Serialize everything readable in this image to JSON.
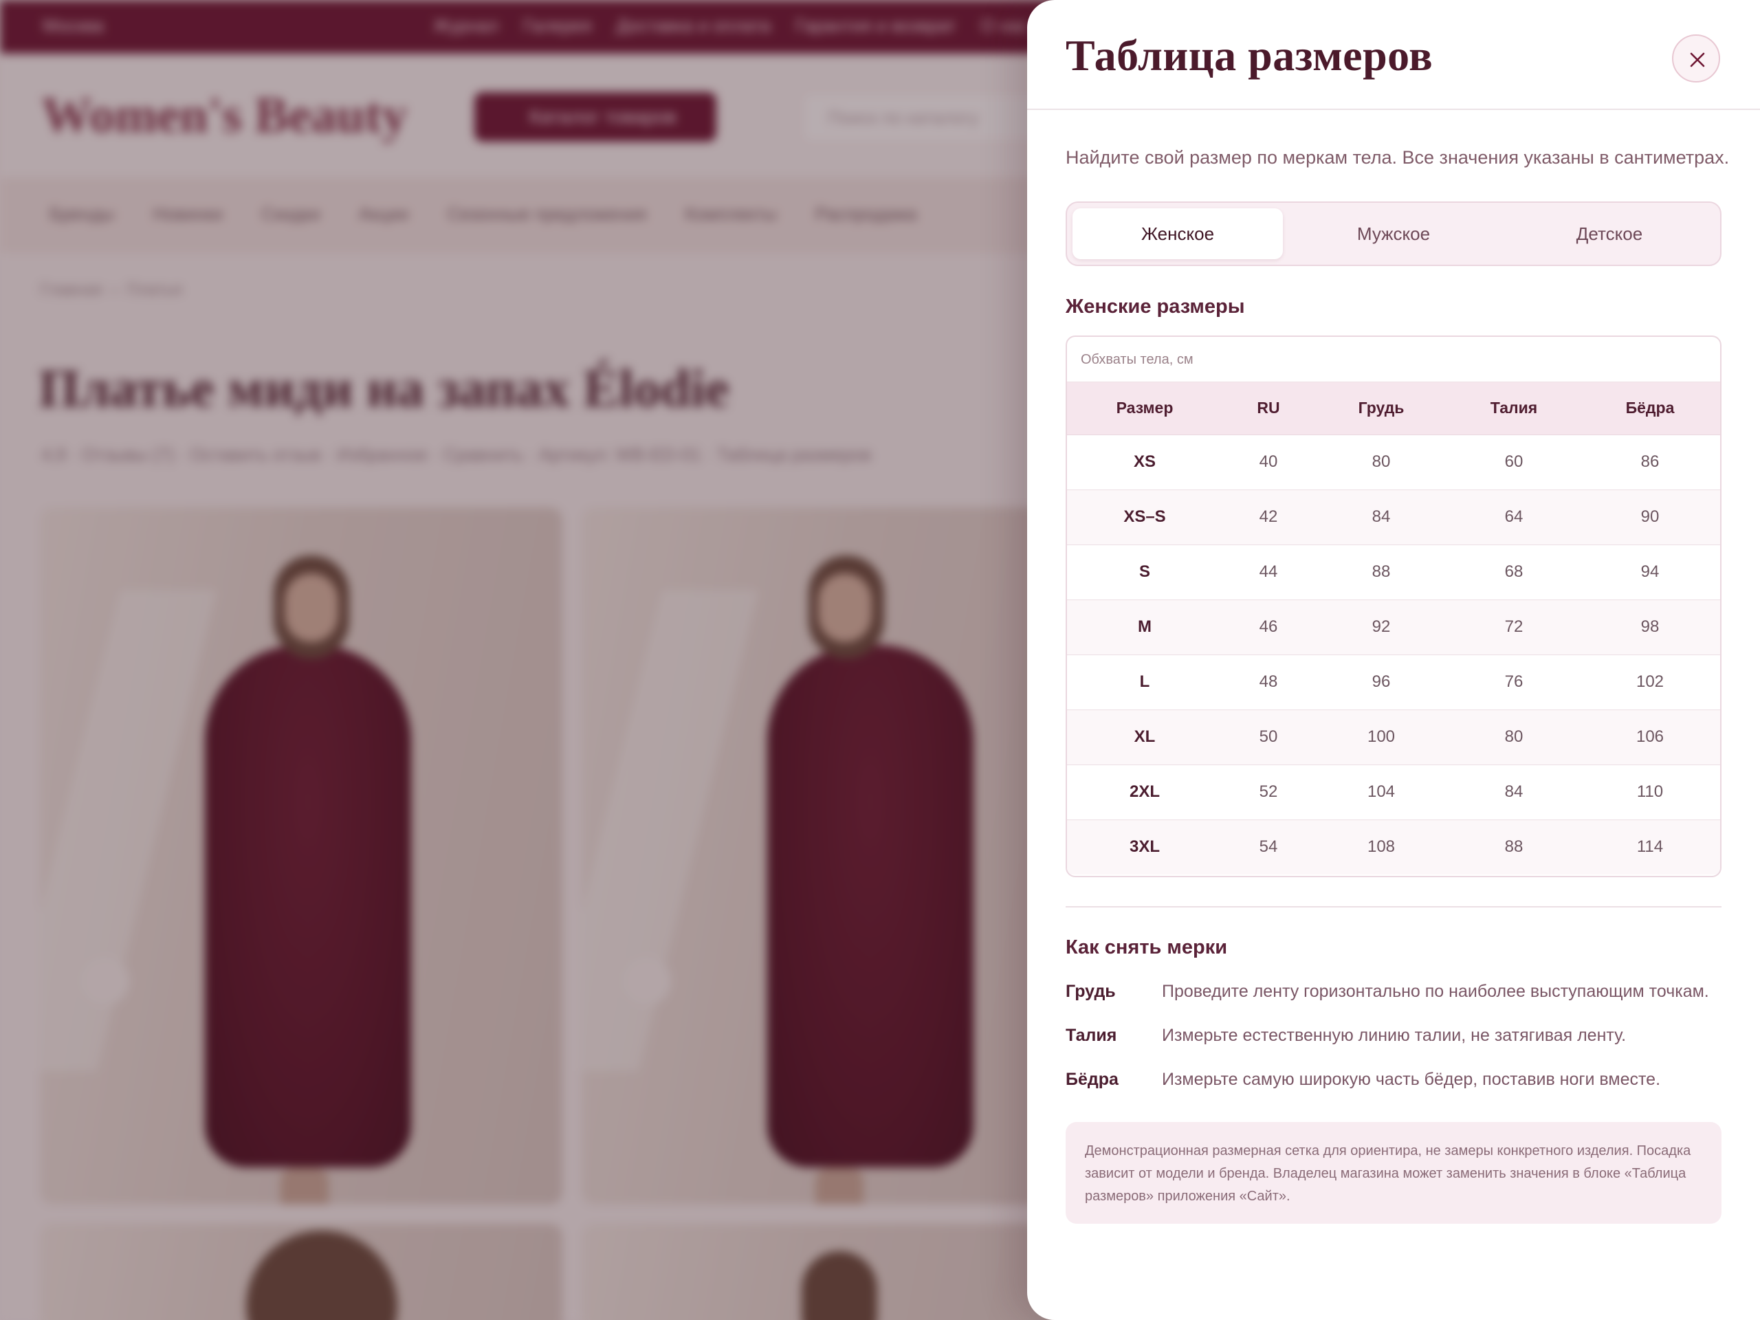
{
  "background": {
    "city": "Москва",
    "top_links": [
      "Журнал",
      "Галерея",
      "Доставка и оплата",
      "Гарантия и возврат",
      "О нас"
    ],
    "logo": "Women's Beauty",
    "catalog_button": "Каталог товаров",
    "search_placeholder": "Поиск по каталогу",
    "category_nav": [
      "Бренды",
      "Новинки",
      "Скидки",
      "Акции",
      "Сезонные предложения",
      "Комплекты",
      "Распродажа"
    ],
    "breadcrumb": [
      "Главная",
      "Платья"
    ],
    "product_title": "Платье миди на запах Élodie",
    "meta": "4,9 · Отзывы (7) · Оставить отзыв · Избранное · Сравнить · Артикул: WB-ED-01 · Таблица размеров"
  },
  "drawer": {
    "title": "Таблица размеров",
    "intro": "Найдите свой размер по меркам тела. Все значения указаны в сантиметрах.",
    "tabs": [
      {
        "label": "Женское",
        "active": true
      },
      {
        "label": "Мужское",
        "active": false
      },
      {
        "label": "Детское",
        "active": false
      }
    ],
    "section_title": "Женские размеры",
    "table": {
      "caption": "Обхваты тела, см",
      "columns": [
        "Размер",
        "RU",
        "Грудь",
        "Талия",
        "Бёдра"
      ],
      "rows": [
        [
          "XS",
          "40",
          "80",
          "60",
          "86"
        ],
        [
          "XS–S",
          "42",
          "84",
          "64",
          "90"
        ],
        [
          "S",
          "44",
          "88",
          "68",
          "94"
        ],
        [
          "M",
          "46",
          "92",
          "72",
          "98"
        ],
        [
          "L",
          "48",
          "96",
          "76",
          "102"
        ],
        [
          "XL",
          "50",
          "100",
          "80",
          "106"
        ],
        [
          "2XL",
          "52",
          "104",
          "84",
          "110"
        ],
        [
          "3XL",
          "54",
          "108",
          "88",
          "114"
        ]
      ]
    },
    "howto_title": "Как снять мерки",
    "howto": [
      {
        "term": "Грудь",
        "desc": "Проведите ленту горизонтально по наиболее выступающим точкам."
      },
      {
        "term": "Талия",
        "desc": "Измерьте естественную линию талии, не затягивая ленту."
      },
      {
        "term": "Бёдра",
        "desc": "Измерьте самую широкую часть бёдер, поставив ноги вместе."
      }
    ],
    "note": "Демонстрационная размерная сетка для ориентира, не замеры конкретного изделия. Посадка зависит от модели и бренда. Владелец магазина может заменить значения в блоке «Таблица размеров» приложения «Сайт»."
  },
  "colors": {
    "brand": "#6e1532",
    "title": "#4b1a2b",
    "tab_bg": "#f9eef3",
    "note_bg": "#f8ecf1"
  },
  "icons": [
    "close-icon",
    "location-icon",
    "zoom-icon"
  ]
}
